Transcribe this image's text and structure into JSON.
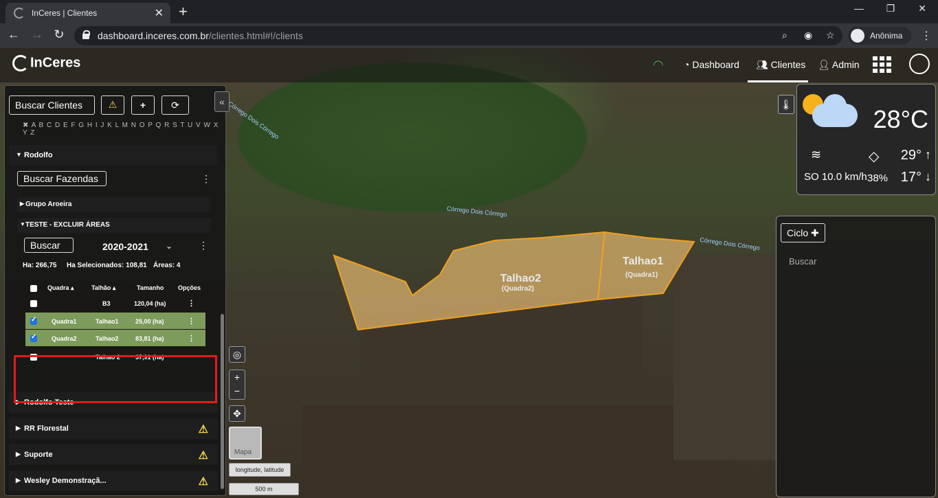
{
  "browser": {
    "tab_title": "InCeres | Clientes",
    "tab_close": "✕",
    "new_tab": "+",
    "url_host": "dashboard.inceres.com.br",
    "url_path": "/clientes.html#!/clients",
    "profile_label": "Anônima",
    "window_min": "—",
    "window_max": "❐",
    "window_close": "✕"
  },
  "header": {
    "logo": "InCeres",
    "nav": [
      {
        "label": "Dashboard",
        "icon": "tachometer-icon"
      },
      {
        "label": "Clientes",
        "icon": "users-icon"
      },
      {
        "label": "Admin",
        "icon": "user-plus-icon"
      }
    ]
  },
  "left_panel": {
    "search_clients": "Buscar Clientes",
    "alphabet": "✖ A B C D E F G H I J K L M N O P Q R S T U V W X Y Z",
    "client_open": "Rodolfo",
    "search_farms": "Buscar Fazendas",
    "groups": [
      "Grupo Aroeira",
      "TESTE - EXCLUIR ÁREAS"
    ],
    "search": "Buscar",
    "season": "2020-2021",
    "stats": {
      "ha": "Ha: 266,75",
      "ha_selected": "Ha Selecionados: 108,81",
      "areas": "Áreas: 4"
    },
    "table_headers": [
      "Quadra",
      "Talhão",
      "Tamanho",
      "Opções"
    ],
    "rows": [
      {
        "quadra": "",
        "talhao": "B3",
        "tamanho": "120,04 (ha)",
        "checked": false
      },
      {
        "quadra": "Quadra1",
        "talhao": "Talhao1",
        "tamanho": "25,00 (ha)",
        "checked": true
      },
      {
        "quadra": "Quadra2",
        "talhao": "Talhao2",
        "tamanho": "83,81 (ha)",
        "checked": true
      },
      {
        "quadra": "",
        "talhao": "Talhao 2",
        "tamanho": "37,91 (ha)",
        "checked": false
      }
    ],
    "other_clients": [
      {
        "label": "Rodolfo Teste",
        "warn": false
      },
      {
        "label": "RR Florestal",
        "warn": true
      },
      {
        "label": "Suporte",
        "warn": true
      },
      {
        "label": "Wesley Demonstraçã...",
        "warn": true
      }
    ]
  },
  "map": {
    "fields": [
      {
        "name": "Talhao2",
        "quadra": "(Quadra2)"
      },
      {
        "name": "Talhao1",
        "quadra": "(Quadra1)"
      }
    ],
    "river_label": "Córrego Dois Córrego",
    "minimap_label": "Mapa",
    "coords_label": "longitude, latitude",
    "scale_label": "500 m",
    "field_color": "#d9b26b",
    "field_border": "#f0a020"
  },
  "weather": {
    "temp": "28°C",
    "wind": "SO 10.0 km/h",
    "humidity": "38%",
    "high": "29°",
    "low": "17°"
  },
  "right_panel": {
    "ciclo": "Ciclo",
    "search": "Buscar"
  }
}
